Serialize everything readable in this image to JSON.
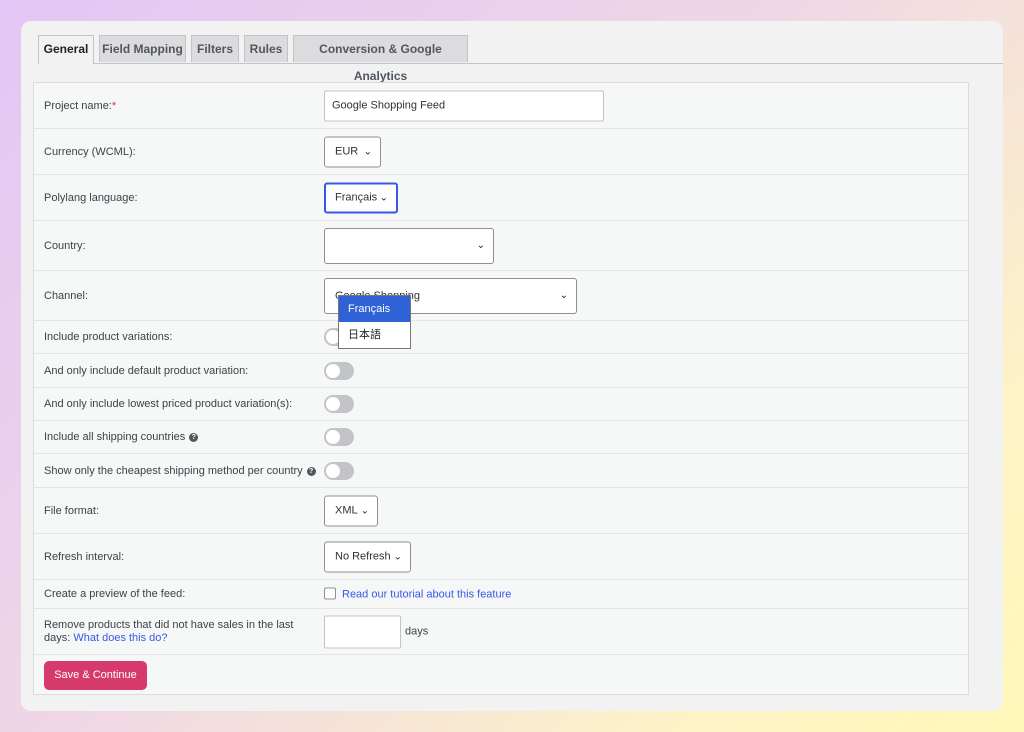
{
  "tabs": [
    {
      "label": "General"
    },
    {
      "label": "Field Mapping"
    },
    {
      "label": "Filters"
    },
    {
      "label": "Rules"
    },
    {
      "label": "Conversion & Google Analytics"
    }
  ],
  "form": {
    "project_name": {
      "label": "Project name:",
      "required_mark": "*",
      "value": "Google Shopping Feed"
    },
    "currency": {
      "label": "Currency (WCML):",
      "value": "EUR"
    },
    "language": {
      "label": "Polylang language:",
      "value": "Français",
      "options": [
        "Français",
        "日本語"
      ]
    },
    "country": {
      "label": "Country:",
      "value": ""
    },
    "channel": {
      "label": "Channel:",
      "value": "Google Shopping"
    },
    "include_variations": {
      "label": "Include product variations:",
      "checked": false
    },
    "default_variation": {
      "label": "And only include default product variation:",
      "checked": false
    },
    "lowest_priced": {
      "label": "And only include lowest priced product variation(s):",
      "checked": false
    },
    "all_shipping": {
      "label": "Include all shipping countries",
      "help_icon": "question-circle-icon",
      "checked": false
    },
    "cheapest_shipping": {
      "label": "Show only the cheapest shipping method per country",
      "help_icon": "question-circle-icon",
      "checked": false
    },
    "file_format": {
      "label": "File format:",
      "value": "XML"
    },
    "refresh_interval": {
      "label": "Refresh interval:",
      "value": "No Refresh"
    },
    "preview": {
      "label": "Create a preview of the feed:",
      "link": "Read our tutorial about this feature",
      "checked": false
    },
    "remove_products": {
      "label_line1": "Remove products that did not have sales in the last",
      "label_line2": "days:",
      "link": "What does this do?",
      "value": "",
      "unit": "days"
    }
  },
  "save_button": "Save & Continue",
  "colors": {
    "accent": "#3858e9",
    "save_button": "#d63a6c",
    "selected_option": "#2f62d6"
  }
}
